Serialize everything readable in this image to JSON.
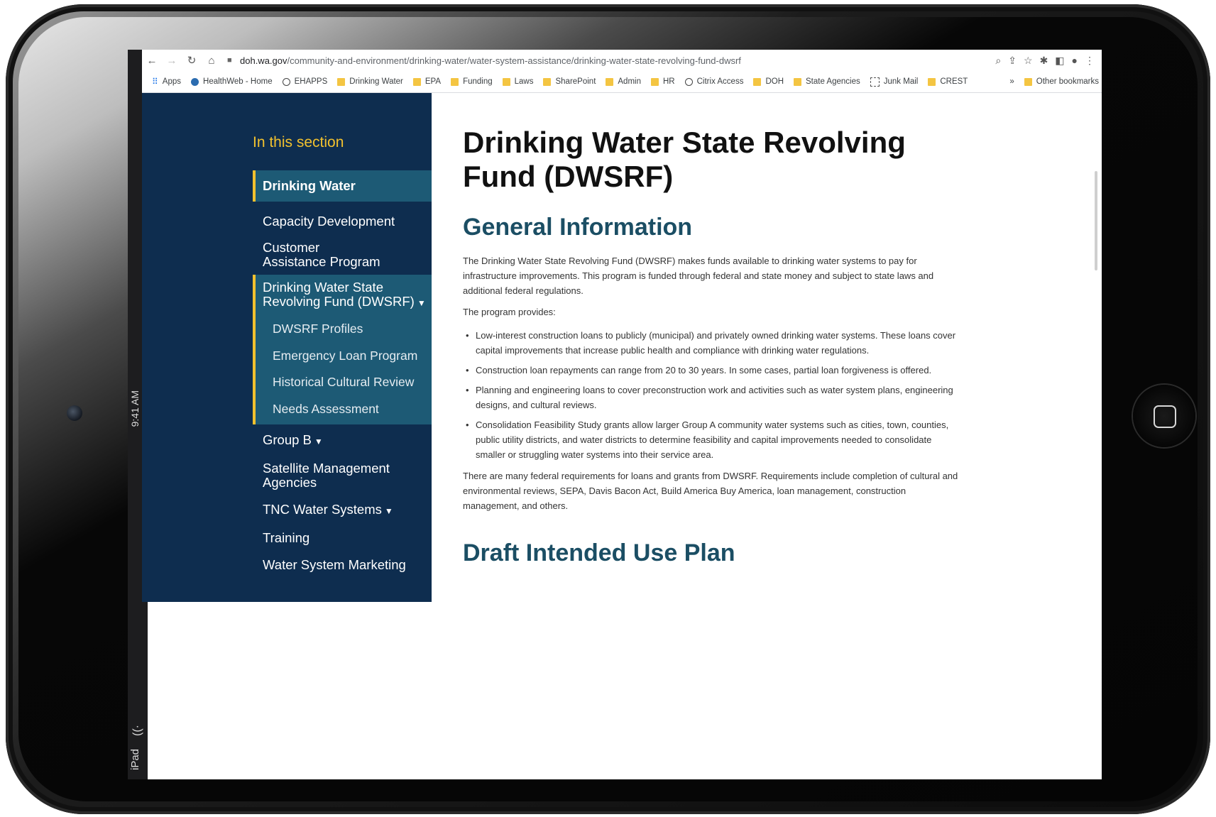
{
  "device": {
    "label": "iPad"
  },
  "browser": {
    "url_domain": "doh.wa.gov",
    "url_path": "/community-and-environment/drinking-water/water-system-assistance/drinking-water-state-revolving-fund-dwsrf",
    "bookmarks": [
      {
        "label": "Apps",
        "icon": "apps-grid-icon"
      },
      {
        "label": "HealthWeb - Home",
        "icon": "site-icon"
      },
      {
        "label": "EHAPPS",
        "icon": "globe-icon"
      },
      {
        "label": "Drinking Water",
        "icon": "folder-icon"
      },
      {
        "label": "EPA",
        "icon": "folder-icon"
      },
      {
        "label": "Funding",
        "icon": "folder-icon"
      },
      {
        "label": "Laws",
        "icon": "folder-icon"
      },
      {
        "label": "SharePoint",
        "icon": "folder-icon"
      },
      {
        "label": "Admin",
        "icon": "folder-icon"
      },
      {
        "label": "HR",
        "icon": "folder-icon"
      },
      {
        "label": "Citrix Access",
        "icon": "globe-icon"
      },
      {
        "label": "DOH",
        "icon": "folder-icon"
      },
      {
        "label": "State Agencies",
        "icon": "folder-icon"
      },
      {
        "label": "Junk Mail",
        "icon": "site-icon"
      },
      {
        "label": "CREST",
        "icon": "folder-icon"
      }
    ],
    "more_bookmarks": "»",
    "other_bookmarks": "Other bookmarks"
  },
  "sidebar": {
    "title": "In this section",
    "active_item": "Drinking Water",
    "items_before": [
      "Capacity Development",
      "Customer Assistance Program"
    ],
    "expanded_group": {
      "label": "Drinking Water State Revolving Fund (DWSRF)",
      "children": [
        "DWSRF Profiles",
        "Emergency Loan Program",
        "Historical Cultural Review",
        "Needs Assessment"
      ]
    },
    "items_after": [
      "Group B",
      "Satellite Management Agencies",
      "TNC Water Systems",
      "Training",
      "Water System Marketing"
    ]
  },
  "content": {
    "title": "Drinking Water State Revolving Fund (DWSRF)",
    "heading": "General Information",
    "intro": "The Drinking Water State Revolving Fund (DWSRF) makes funds available to drinking water systems to pay for infrastructure improvements. This program is funded through federal and state money and subject to state laws and additional federal regulations.",
    "provides_label": "The program provides:",
    "bullets": [
      "Low-interest construction loans to publicly (municipal) and privately owned drinking water systems. These loans cover capital improvements that increase public health and compliance with drinking water regulations.",
      "Construction loan repayments can range from 20 to 30 years. In some cases, partial loan forgiveness is offered.",
      "Planning and engineering loans to cover preconstruction work and activities such as water system plans, engineering designs, and cultural reviews.",
      "Consolidation Feasibility Study grants allow larger Group A community water systems such as cities, town, counties, public utility districts, and water districts to determine feasibility and capital improvements needed to consolidate smaller or struggling water systems into their service area."
    ],
    "requirements": "There are many federal requirements for loans and grants from DWSRF. Requirements include completion of cultural and environmental reviews, SEPA, Davis Bacon Act, Build America Buy America, loan management, construction management, and others.",
    "next_heading": "Draft Intended Use Plan"
  }
}
